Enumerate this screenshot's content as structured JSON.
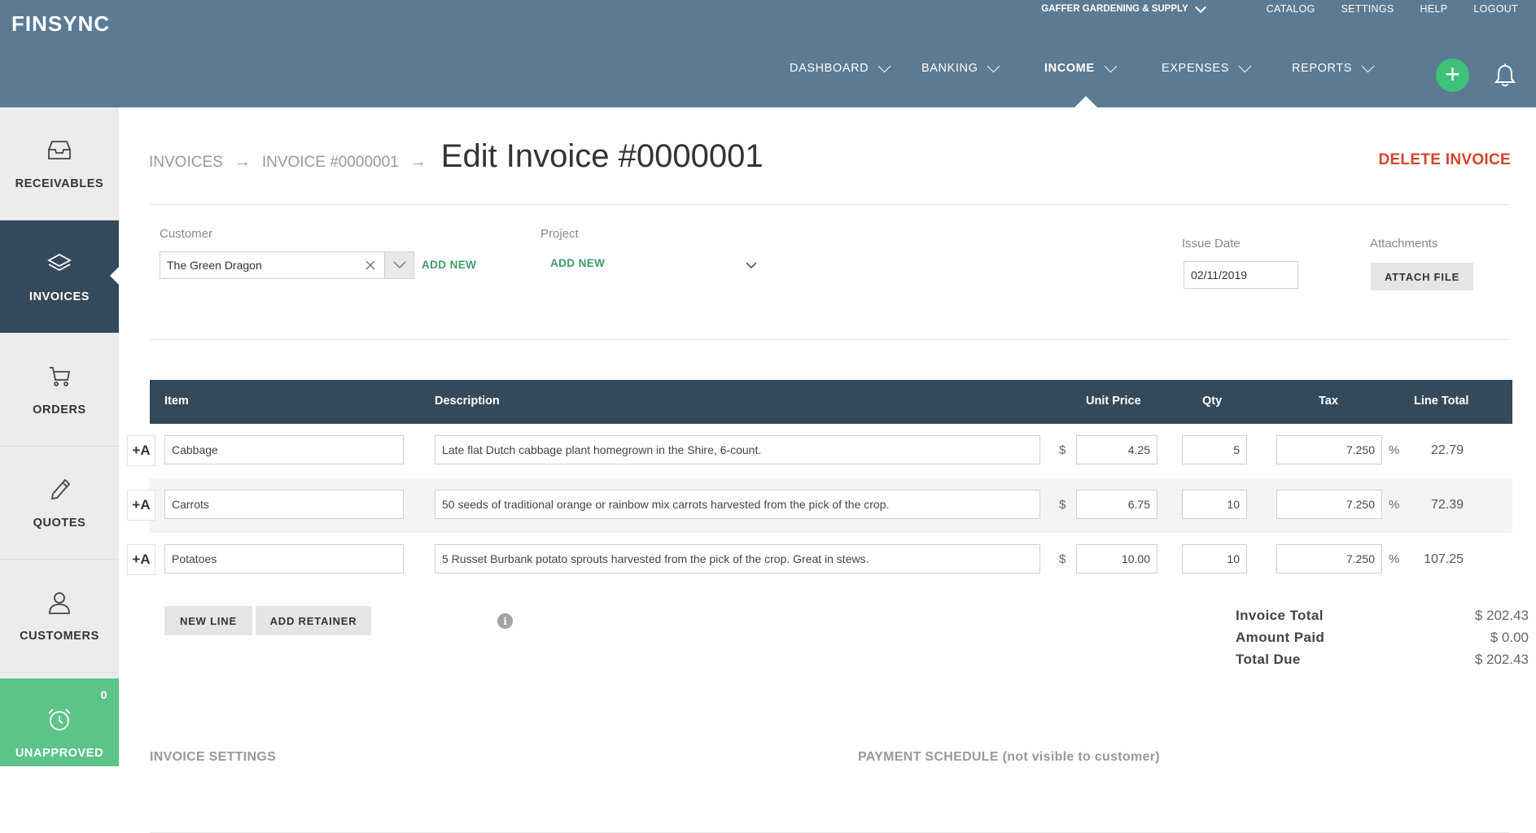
{
  "app": {
    "logo": "FINSYNC"
  },
  "utility_nav": {
    "company": "GAFFER GARDENING & SUPPLY",
    "links": [
      "CATALOG",
      "SETTINGS",
      "HELP",
      "LOGOUT"
    ]
  },
  "main_nav": {
    "items": [
      "DASHBOARD",
      "BANKING",
      "INCOME",
      "EXPENSES",
      "REPORTS"
    ],
    "active": "INCOME",
    "plus_label": "+"
  },
  "sidebar": {
    "items": [
      {
        "label": "RECEIVABLES",
        "icon": "inbox-tray-icon"
      },
      {
        "label": "INVOICES",
        "icon": "stack-layers-icon"
      },
      {
        "label": "ORDERS",
        "icon": "cart-icon"
      },
      {
        "label": "QUOTES",
        "icon": "pencil-icon"
      },
      {
        "label": "CUSTOMERS",
        "icon": "person-icon"
      },
      {
        "label": "UNAPPROVED",
        "icon": "alarm-clock-icon",
        "badge": "0"
      }
    ],
    "active": "INVOICES"
  },
  "breadcrumb": {
    "items": [
      "INVOICES",
      "INVOICE #0000001"
    ],
    "arrow": "→",
    "title": "Edit Invoice #0000001"
  },
  "actions": {
    "delete": "DELETE INVOICE"
  },
  "form": {
    "customer_label": "Customer",
    "customer_value": "The Green Dragon",
    "customer_add": "ADD NEW",
    "project_label": "Project",
    "project_value": "ADD NEW",
    "issue_date_label": "Issue Date",
    "issue_date_value": "02/11/2019",
    "attachments_label": "Attachments",
    "attach_button": "ATTACH FILE"
  },
  "table": {
    "columns": [
      "Item",
      "Description",
      "Unit Price",
      "Qty",
      "Tax",
      "Line Total"
    ],
    "add_item_label": "+A",
    "currency_symbol": "$",
    "percent_symbol": "%",
    "rows": [
      {
        "item": "Cabbage",
        "description": "Late flat Dutch cabbage plant homegrown in the Shire, 6-count.",
        "unit_price": "4.25",
        "qty": "5",
        "tax": "7.250",
        "line_total": "22.79"
      },
      {
        "item": "Carrots",
        "description": "50 seeds of traditional orange or rainbow mix carrots harvested from the pick of the crop.",
        "unit_price": "6.75",
        "qty": "10",
        "tax": "7.250",
        "line_total": "72.39"
      },
      {
        "item": "Potatoes",
        "description": "5 Russet Burbank potato sprouts harvested from the pick of the crop. Great in stews.",
        "unit_price": "10.00",
        "qty": "10",
        "tax": "7.250",
        "line_total": "107.25"
      }
    ]
  },
  "line_actions": {
    "new_line": "NEW LINE",
    "add_retainer": "ADD RETAINER",
    "info": "i"
  },
  "totals": [
    {
      "label": "Invoice Total",
      "value": "$ 202.43"
    },
    {
      "label": "Amount Paid",
      "value": "$ 0.00"
    },
    {
      "label": "Total Due",
      "value": "$ 202.43"
    }
  ],
  "sections": {
    "invoice_settings": "INVOICE SETTINGS",
    "payment_schedule": "PAYMENT SCHEDULE (not visible to customer)"
  },
  "colors": {
    "topbar": "#5b7a93",
    "sidebar_active": "#34495a",
    "accent_green": "#3ec27a",
    "delete_red": "#d2452b"
  }
}
